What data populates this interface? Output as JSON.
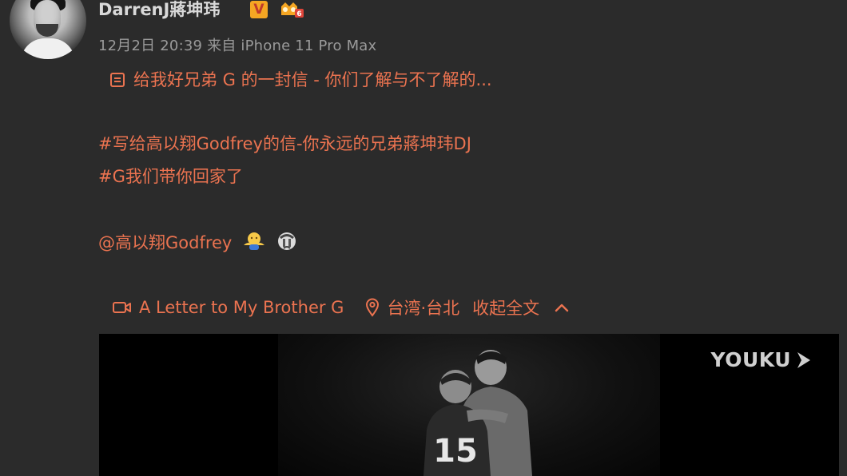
{
  "post": {
    "username": "DarrenJ蔣坤玮",
    "verified_badge": "V",
    "level_badge": "6",
    "meta": "12月2日 20:39 来自 iPhone 11 Pro Max",
    "article_line": "给我好兄弟 G 的一封信 - 你们了解与不了解的...",
    "hashtag_1": "#写给高以翔Godfrey的信-你永远的兄弟蔣坤玮DJ",
    "hashtag_2": "#G我们带你回家了",
    "mention": "@高以翔Godfrey",
    "emoji_icons": [
      "hug-emoji",
      "sad-emoji"
    ]
  },
  "attachments": {
    "video_label": "A Letter to My Brother G",
    "location": "台湾·台北",
    "collapse": "收起全文"
  },
  "video": {
    "watermark": "YOUKU",
    "jersey_number": "15"
  },
  "colors": {
    "accent": "#eb7350",
    "background": "#2b2b2b",
    "meta": "#9a9a9a"
  }
}
